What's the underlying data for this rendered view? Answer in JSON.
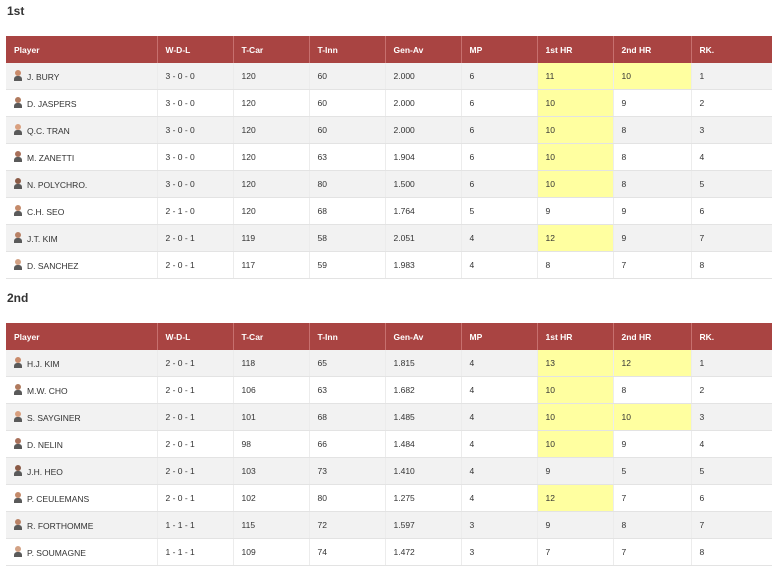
{
  "sections": [
    {
      "title": "1st",
      "headers": [
        "Player",
        "W-D-L",
        "T-Car",
        "T-Inn",
        "Gen-Av",
        "MP",
        "1st HR",
        "2nd HR",
        "RK."
      ],
      "rows": [
        {
          "player": "J. BURY",
          "wdl": "3 - 0 - 0",
          "tcar": "120",
          "tinn": "60",
          "genav": "2.000",
          "mp": "6",
          "hr1": "11",
          "hr2": "10",
          "rk": "1",
          "hl1": true,
          "hl2": true
        },
        {
          "player": "D. JASPERS",
          "wdl": "3 - 0 - 0",
          "tcar": "120",
          "tinn": "60",
          "genav": "2.000",
          "mp": "6",
          "hr1": "10",
          "hr2": "9",
          "rk": "2",
          "hl1": true,
          "hl2": false
        },
        {
          "player": "Q.C. TRAN",
          "wdl": "3 - 0 - 0",
          "tcar": "120",
          "tinn": "60",
          "genav": "2.000",
          "mp": "6",
          "hr1": "10",
          "hr2": "8",
          "rk": "3",
          "hl1": true,
          "hl2": false
        },
        {
          "player": "M. ZANETTI",
          "wdl": "3 - 0 - 0",
          "tcar": "120",
          "tinn": "63",
          "genav": "1.904",
          "mp": "6",
          "hr1": "10",
          "hr2": "8",
          "rk": "4",
          "hl1": true,
          "hl2": false
        },
        {
          "player": "N. POLYCHRO.",
          "wdl": "3 - 0 - 0",
          "tcar": "120",
          "tinn": "80",
          "genav": "1.500",
          "mp": "6",
          "hr1": "10",
          "hr2": "8",
          "rk": "5",
          "hl1": true,
          "hl2": false
        },
        {
          "player": "C.H. SEO",
          "wdl": "2 - 1 - 0",
          "tcar": "120",
          "tinn": "68",
          "genav": "1.764",
          "mp": "5",
          "hr1": "9",
          "hr2": "9",
          "rk": "6",
          "hl1": false,
          "hl2": false
        },
        {
          "player": "J.T. KIM",
          "wdl": "2 - 0 - 1",
          "tcar": "119",
          "tinn": "58",
          "genav": "2.051",
          "mp": "4",
          "hr1": "12",
          "hr2": "9",
          "rk": "7",
          "hl1": true,
          "hl2": false
        },
        {
          "player": "D. SANCHEZ",
          "wdl": "2 - 0 - 1",
          "tcar": "117",
          "tinn": "59",
          "genav": "1.983",
          "mp": "4",
          "hr1": "8",
          "hr2": "7",
          "rk": "8",
          "hl1": false,
          "hl2": false
        }
      ]
    },
    {
      "title": "2nd",
      "headers": [
        "Player",
        "W-D-L",
        "T-Car",
        "T-Inn",
        "Gen-Av",
        "MP",
        "1st HR",
        "2nd HR",
        "RK."
      ],
      "rows": [
        {
          "player": "H.J. KIM",
          "wdl": "2 - 0 - 1",
          "tcar": "118",
          "tinn": "65",
          "genav": "1.815",
          "mp": "4",
          "hr1": "13",
          "hr2": "12",
          "rk": "1",
          "hl1": true,
          "hl2": true
        },
        {
          "player": "M.W. CHO",
          "wdl": "2 - 0 - 1",
          "tcar": "106",
          "tinn": "63",
          "genav": "1.682",
          "mp": "4",
          "hr1": "10",
          "hr2": "8",
          "rk": "2",
          "hl1": true,
          "hl2": false
        },
        {
          "player": "S. SAYGINER",
          "wdl": "2 - 0 - 1",
          "tcar": "101",
          "tinn": "68",
          "genav": "1.485",
          "mp": "4",
          "hr1": "10",
          "hr2": "10",
          "rk": "3",
          "hl1": true,
          "hl2": true
        },
        {
          "player": "D. NELIN",
          "wdl": "2 - 0 - 1",
          "tcar": "98",
          "tinn": "66",
          "genav": "1.484",
          "mp": "4",
          "hr1": "10",
          "hr2": "9",
          "rk": "4",
          "hl1": true,
          "hl2": false
        },
        {
          "player": "J.H. HEO",
          "wdl": "2 - 0 - 1",
          "tcar": "103",
          "tinn": "73",
          "genav": "1.410",
          "mp": "4",
          "hr1": "9",
          "hr2": "5",
          "rk": "5",
          "hl1": false,
          "hl2": false
        },
        {
          "player": "P. CEULEMANS",
          "wdl": "2 - 0 - 1",
          "tcar": "102",
          "tinn": "80",
          "genav": "1.275",
          "mp": "4",
          "hr1": "12",
          "hr2": "7",
          "rk": "6",
          "hl1": true,
          "hl2": false
        },
        {
          "player": "R. FORTHOMME",
          "wdl": "1 - 1 - 1",
          "tcar": "115",
          "tinn": "72",
          "genav": "1.597",
          "mp": "3",
          "hr1": "9",
          "hr2": "8",
          "rk": "7",
          "hl1": false,
          "hl2": false
        },
        {
          "player": "P. SOUMAGNE",
          "wdl": "1 - 1 - 1",
          "tcar": "109",
          "tinn": "74",
          "genav": "1.472",
          "mp": "3",
          "hr1": "7",
          "hr2": "7",
          "rk": "8",
          "hl1": false,
          "hl2": false
        }
      ]
    }
  ]
}
